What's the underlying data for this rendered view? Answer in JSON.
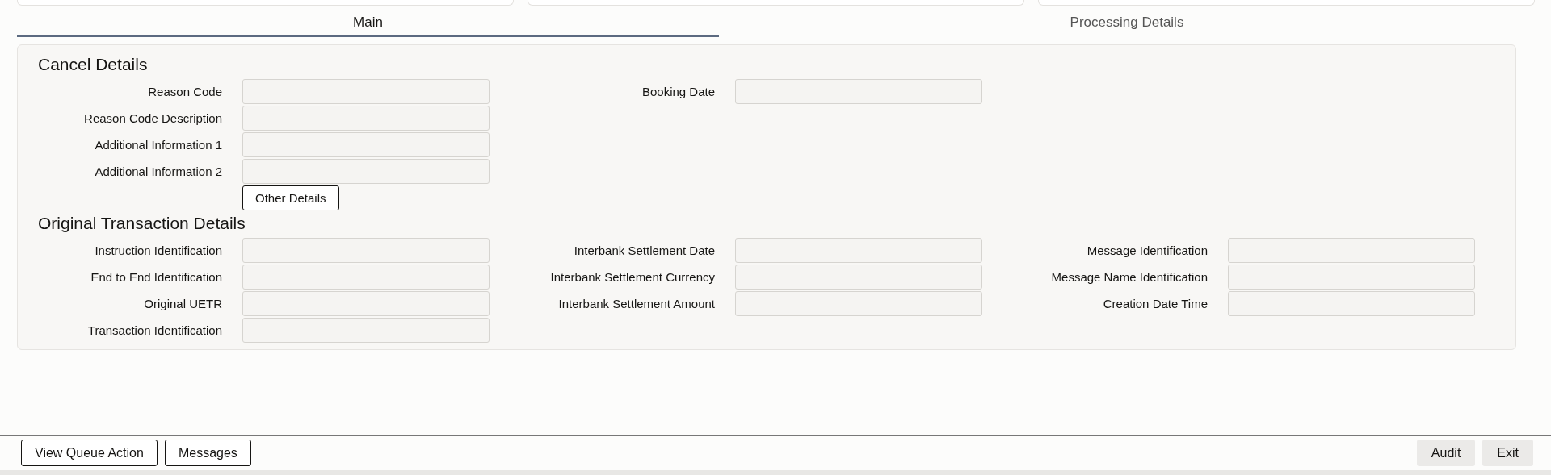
{
  "tabs": [
    {
      "label": "Main",
      "selected": true
    },
    {
      "label": "Processing Details",
      "selected": false
    }
  ],
  "sections": [
    {
      "title": "Cancel Details",
      "columns": [
        [
          {
            "label": "Reason Code"
          },
          {
            "label": "Reason Code Description"
          },
          {
            "label": "Additional Information 1"
          },
          {
            "label": "Additional Information 2"
          }
        ],
        [
          {
            "label": "Booking Date"
          }
        ]
      ],
      "buttons": [
        "Other Details"
      ]
    },
    {
      "title": "Original Transaction Details",
      "columns": [
        [
          {
            "label": "Instruction Identification"
          },
          {
            "label": "End to End Identification"
          },
          {
            "label": "Original UETR"
          },
          {
            "label": "Transaction Identification"
          }
        ],
        [
          {
            "label": "Interbank Settlement Date"
          },
          {
            "label": "Interbank Settlement Currency"
          },
          {
            "label": "Interbank Settlement Amount"
          }
        ],
        [
          {
            "label": "Message Identification"
          },
          {
            "label": "Message Name Identification"
          },
          {
            "label": "Creation Date Time"
          }
        ]
      ]
    }
  ],
  "footer": {
    "left_buttons": [
      "View Queue Action",
      "Messages"
    ],
    "right_buttons": [
      "Audit",
      "Exit"
    ]
  }
}
